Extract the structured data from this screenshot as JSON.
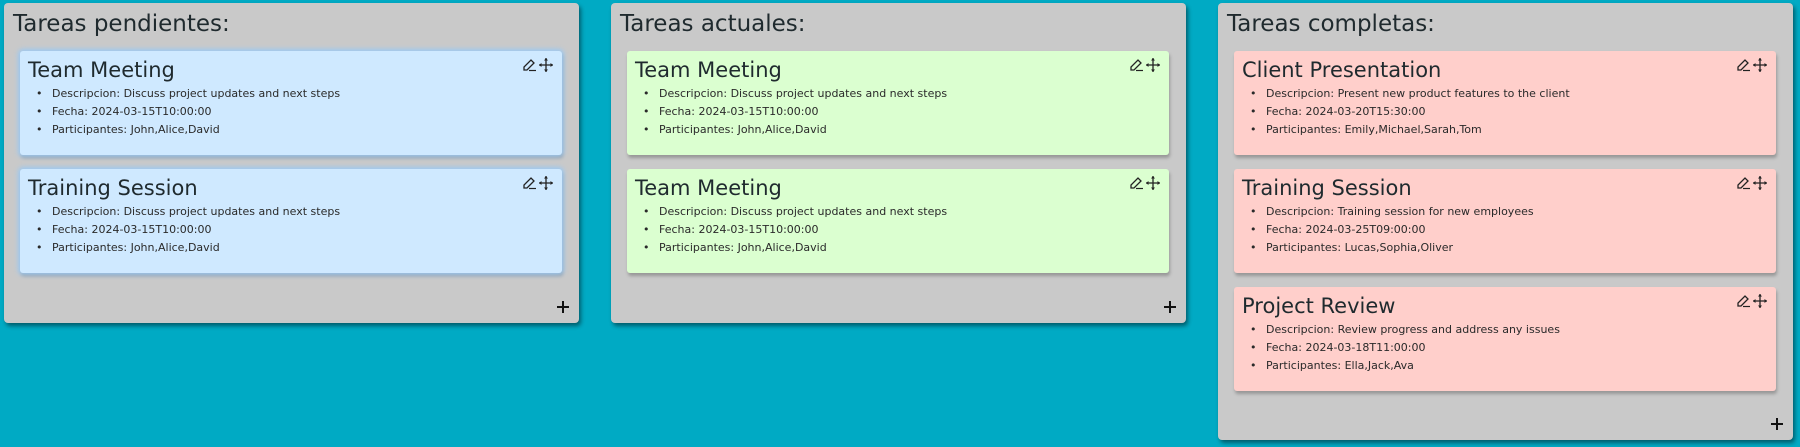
{
  "columns": [
    {
      "title": "Tareas pendientes:",
      "color": "#cfe9ff",
      "cards": [
        {
          "title": "Team Meeting",
          "descripcion": "Descripcion: Discuss project updates and next steps",
          "fecha": "Fecha: 2024-03-15T10:00:00",
          "participantes": "Participantes: John,Alice,David"
        },
        {
          "title": "Training Session",
          "descripcion": "Descripcion: Discuss project updates and next steps",
          "fecha": "Fecha: 2024-03-15T10:00:00",
          "participantes": "Participantes: John,Alice,David"
        }
      ]
    },
    {
      "title": "Tareas actuales:",
      "color": "#dbffd0",
      "cards": [
        {
          "title": "Team Meeting",
          "descripcion": "Descripcion: Discuss project updates and next steps",
          "fecha": "Fecha: 2024-03-15T10:00:00",
          "participantes": "Participantes: John,Alice,David"
        },
        {
          "title": "Team Meeting",
          "descripcion": "Descripcion: Discuss project updates and next steps",
          "fecha": "Fecha: 2024-03-15T10:00:00",
          "participantes": "Participantes: John,Alice,David"
        }
      ]
    },
    {
      "title": "Tareas completas:",
      "color": "#ffcfcb",
      "cards": [
        {
          "title": "Client Presentation",
          "descripcion": "Descripcion: Present new product features to the client",
          "fecha": "Fecha: 2024-03-20T15:30:00",
          "participantes": "Participantes: Emily,Michael,Sarah,Tom"
        },
        {
          "title": "Training Session",
          "descripcion": "Descripcion: Training session for new employees",
          "fecha": "Fecha: 2024-03-25T09:00:00",
          "participantes": "Participantes: Lucas,Sophia,Oliver"
        },
        {
          "title": "Project Review",
          "descripcion": "Descripcion: Review progress and address any issues",
          "fecha": "Fecha: 2024-03-18T11:00:00",
          "participantes": "Participantes: Ella,Jack,Ava"
        }
      ]
    }
  ],
  "icons": {
    "edit": "pencil-icon",
    "move": "move-icon",
    "add": "plus-icon"
  },
  "colors": {
    "background": "#00aac4",
    "column": "#c9c9c9"
  }
}
